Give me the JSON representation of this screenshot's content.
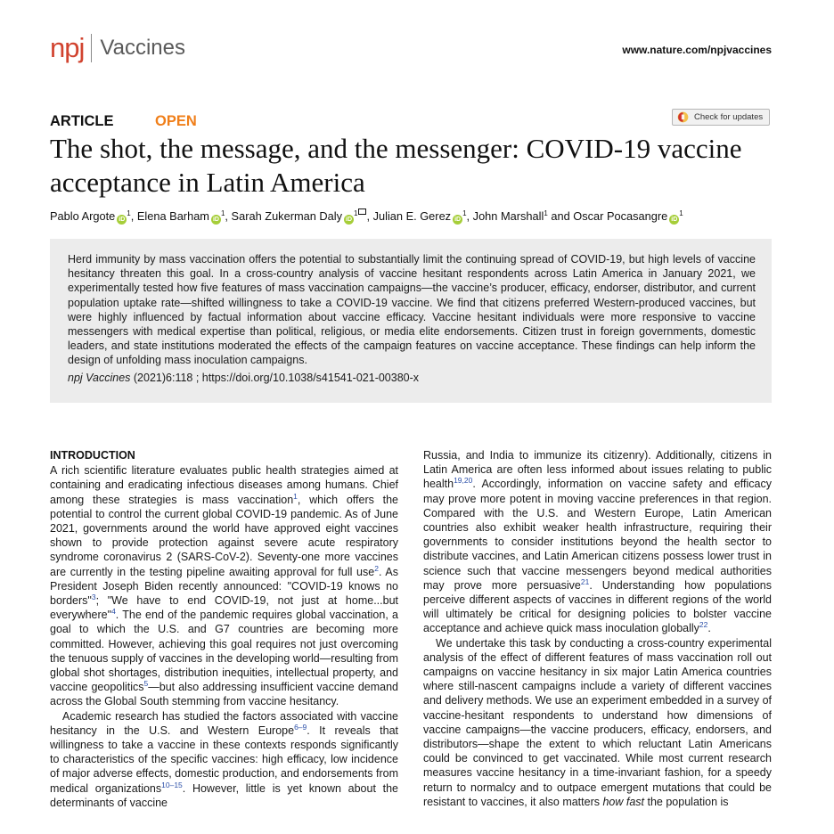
{
  "header": {
    "brand_npj": "npj",
    "brand_name": "Vaccines",
    "site_url": "www.nature.com/npjvaccines"
  },
  "article": {
    "type": "ARTICLE",
    "access": "OPEN",
    "check_updates": "Check for updates",
    "title": "The shot, the message, and the messenger: COVID-19 vaccine acceptance in Latin America"
  },
  "authors": [
    {
      "name": "Pablo Argote",
      "sup": "1",
      "orcid": true
    },
    {
      "name": "Elena Barham",
      "sup": "1",
      "orcid": true
    },
    {
      "name": "Sarah Zukerman Daly",
      "sup": "1",
      "orcid": true,
      "corresponding": true
    },
    {
      "name": "Julian E. Gerez",
      "sup": "1",
      "orcid": true
    },
    {
      "name": "John Marshall",
      "sup": "1",
      "orcid": false
    },
    {
      "name": "Oscar Pocasangre",
      "sup": "1",
      "orcid": true
    }
  ],
  "author_connectors": [
    ", ",
    ", ",
    ", ",
    ", ",
    " and ",
    ""
  ],
  "abstract": {
    "text": "Herd immunity by mass vaccination offers the potential to substantially limit the continuing spread of COVID-19, but high levels of vaccine hesitancy threaten this goal. In a cross-country analysis of vaccine hesitant respondents across Latin America in January 2021, we experimentally tested how five features of mass vaccination campaigns—the vaccine’s producer, efficacy, endorser, distributor, and current population uptake rate—shifted willingness to take a COVID-19 vaccine. We find that citizens preferred Western-produced vaccines, but were highly influenced by factual information about vaccine efficacy. Vaccine hesitant individuals were more responsive to vaccine messengers with medical expertise than political, religious, or media elite endorsements. Citizen trust in foreign governments, domestic leaders, and state institutions moderated the effects of the campaign features on vaccine acceptance. These findings can help inform the design of unfolding mass inoculation campaigns.",
    "journal": "npj Vaccines",
    "citation": " (2021)6:118 ; https://doi.org/10.1038/s41541-021-00380-x"
  },
  "body": {
    "section_heading": "INTRODUCTION",
    "left": {
      "p1_a": "A rich scientific literature evaluates public health strategies aimed at containing and eradicating infectious diseases among humans. Chief among these strategies is mass vaccination",
      "p1_r1": "1",
      "p1_b": ", which offers the potential to control the current global COVID-19 pandemic. As of June 2021, governments around the world have approved eight vaccines shown to provide protection against severe acute respiratory syndrome coronavirus 2 (SARS-CoV-2). Seventy-one more vaccines are currently in the testing pipeline awaiting approval for full use",
      "p1_r2": "2",
      "p1_c": ". As President Joseph Biden recently announced: \"COVID-19 knows no borders\"",
      "p1_r3": "3",
      "p1_d": "; \"We have to end COVID-19, not just at home...but everywhere\"",
      "p1_r4": "4",
      "p1_e": ". The end of the pandemic requires global vaccination, a goal to which the U.S. and G7 countries are becoming more committed. However, achieving this goal requires not just overcoming the tenuous supply of vaccines in the developing world—resulting from global shot shortages, distribution inequities, intellectual property, and vaccine geopolitics",
      "p1_r5": "5",
      "p1_f": "—but also addressing insufficient vaccine demand across the Global South stemming from vaccine hesitancy.",
      "p2_a": "Academic research has studied the factors associated with vaccine hesitancy in the U.S. and Western Europe",
      "p2_r1": "6–9",
      "p2_b": ". It reveals that willingness to take a vaccine in these contexts responds significantly to characteristics of the specific vaccines: high efficacy, low incidence of major adverse effects, domestic production, and endorsements from medical organizations",
      "p2_r2": "10–15",
      "p2_c": ". However, little is yet known about the determinants of vaccine"
    },
    "right": {
      "p1_a": "Russia, and India to immunize its citizenry). Additionally, citizens in Latin America are often less informed about issues relating to public health",
      "p1_r1": "19,20",
      "p1_b": ". Accordingly, information on vaccine safety and efficacy may prove more potent in moving vaccine preferences in that region. Compared with the U.S. and Western Europe, Latin American countries also exhibit weaker health infrastructure, requiring their governments to consider institutions beyond the health sector to distribute vaccines, and Latin American citizens possess lower trust in science such that vaccine messengers beyond medical authorities may prove more persuasive",
      "p1_r2": "21",
      "p1_c": ". Understanding how populations perceive different aspects of vaccines in different regions of the world will ultimately be critical for designing policies to bolster vaccine acceptance and achieve quick mass inoculation globally",
      "p1_r3": "22",
      "p1_d": ".",
      "p2_a": "We undertake this task by conducting a cross-country experimental analysis of the effect of different features of mass vaccination roll out campaigns on vaccine hesitancy in six major Latin America countries where still-nascent campaigns include a variety of different vaccines and delivery methods. We use an experiment embedded in a survey of vaccine-hesitant respondents to understand how dimensions of vaccine campaigns—the vaccine producers, efficacy, endorsers, and distributors—shape the extent to which reluctant Latin Americans could be convinced to get vaccinated. While most current research measures vaccine hesitancy in a time-invariant fashion, for a speedy return to normalcy and to outpace emergent mutations that could be resistant to vaccines, it also matters ",
      "p2_em": "how fast",
      "p2_b": " the population is"
    }
  },
  "colors": {
    "brand_red": "#d1432f",
    "open_orange": "#f07f1a",
    "abstract_bg": "#ececec",
    "ref_blue": "#2b4fa8",
    "orcid_green": "#a6ce39"
  }
}
